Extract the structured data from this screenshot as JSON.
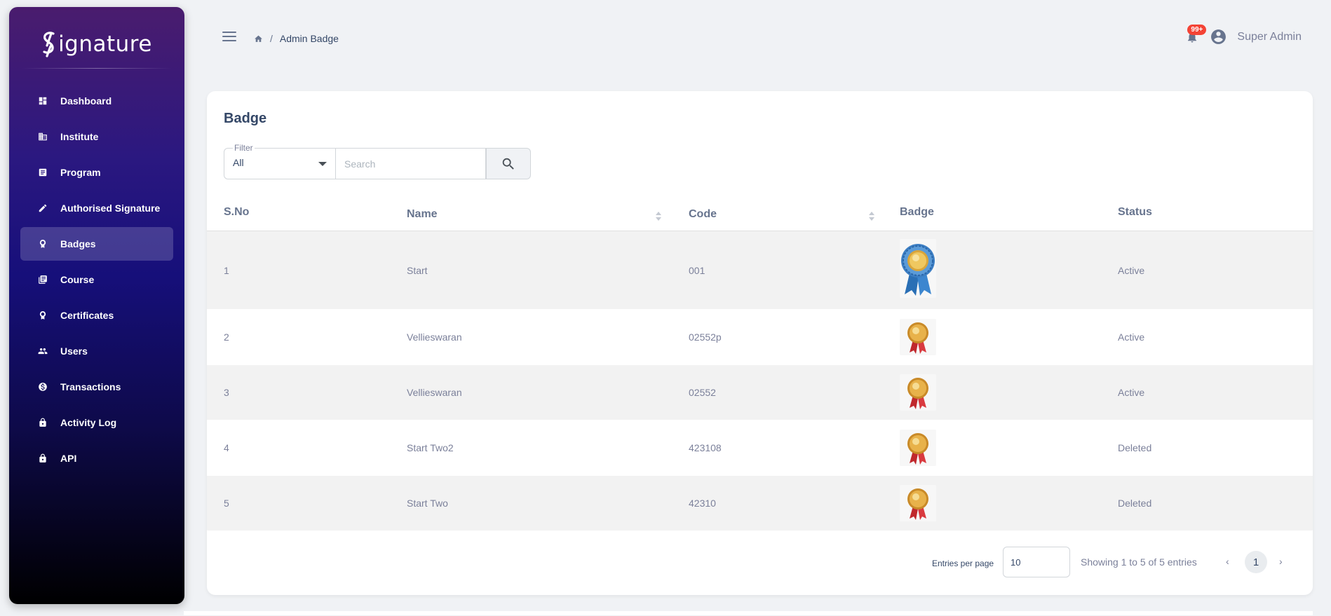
{
  "app": {
    "logo_text": "ignature"
  },
  "sidebar": {
    "items": [
      {
        "label": "Dashboard",
        "icon": "dashboard-icon",
        "active": false
      },
      {
        "label": "Institute",
        "icon": "institute-icon",
        "active": false
      },
      {
        "label": "Program",
        "icon": "program-icon",
        "active": false
      },
      {
        "label": "Authorised Signature",
        "icon": "pen-icon",
        "active": false
      },
      {
        "label": "Badges",
        "icon": "badge-icon",
        "active": true
      },
      {
        "label": "Course",
        "icon": "course-icon",
        "active": false
      },
      {
        "label": "Certificates",
        "icon": "certificate-icon",
        "active": false
      },
      {
        "label": "Users",
        "icon": "users-icon",
        "active": false
      },
      {
        "label": "Transactions",
        "icon": "dollar-icon",
        "active": false
      },
      {
        "label": "Activity Log",
        "icon": "lock-icon",
        "active": false
      },
      {
        "label": "API",
        "icon": "lock-icon",
        "active": false
      }
    ]
  },
  "header": {
    "breadcrumb": {
      "separator": "/",
      "current": "Admin Badge"
    },
    "notifications": {
      "count": "99+"
    },
    "user": {
      "name": "Super Admin"
    }
  },
  "main": {
    "title": "Badge",
    "filter": {
      "label": "Filter",
      "value": "All"
    },
    "search": {
      "placeholder": "Search"
    },
    "table": {
      "columns": [
        "S.No",
        "Name",
        "Code",
        "Badge",
        "Status"
      ],
      "rows": [
        {
          "sno": "1",
          "name": "Start",
          "code": "001",
          "badge": "blue-ribbon-medal",
          "status": "Active"
        },
        {
          "sno": "2",
          "name": "Vellieswaran",
          "code": "02552p",
          "badge": "gold-red-ribbon-medal",
          "status": "Active"
        },
        {
          "sno": "3",
          "name": "Vellieswaran",
          "code": "02552",
          "badge": "gold-red-ribbon-medal",
          "status": "Active"
        },
        {
          "sno": "4",
          "name": "Start Two2",
          "code": "423108",
          "badge": "gold-red-ribbon-medal",
          "status": "Deleted"
        },
        {
          "sno": "5",
          "name": "Start Two",
          "code": "42310",
          "badge": "gold-red-ribbon-medal",
          "status": "Deleted"
        }
      ]
    },
    "pagination": {
      "entries_label": "Entries per page",
      "entries_value": "10",
      "showing": "Showing 1 to 5 of 5 entries",
      "prev": "‹",
      "next": "›",
      "current_page": "1"
    }
  },
  "colors": {
    "sidebar_top": "#4a1c6e",
    "sidebar_mid": "#160f7a",
    "sidebar_bottom": "#000000",
    "notification_red": "#f44335",
    "row_stripe": "#f2f2f2"
  }
}
